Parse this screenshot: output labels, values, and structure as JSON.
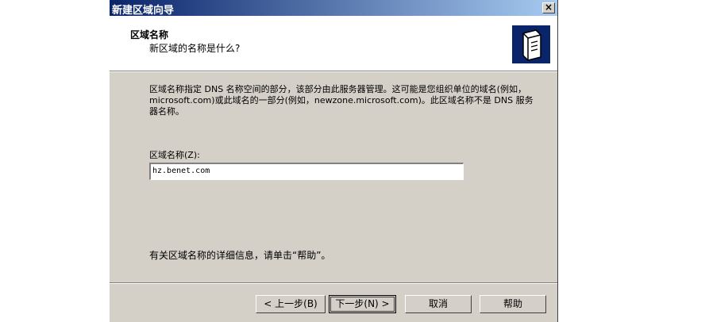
{
  "window": {
    "title": "新建区域向导",
    "close_label": "×"
  },
  "header": {
    "title": "区域名称",
    "subtitle": "新区域的名称是什么?"
  },
  "body": {
    "description": "区域名称指定 DNS 名称空间的部分，该部分由此服务器管理。这可能是您组织单位的域名(例如，microsoft.com)或此域名的一部分(例如，newzone.microsoft.com)。此区域名称不是 DNS 服务器名称。",
    "zone_label": "区域名称(Z):",
    "zone_value": "hz.benet.com",
    "info_text": "有关区域名称的详细信息，请单击“帮助”。"
  },
  "buttons": {
    "back": "< 上一步(B)",
    "next": "下一步(N) >",
    "cancel": "取消",
    "help": "帮助"
  },
  "icons": {
    "header_icon": "server-icon"
  }
}
